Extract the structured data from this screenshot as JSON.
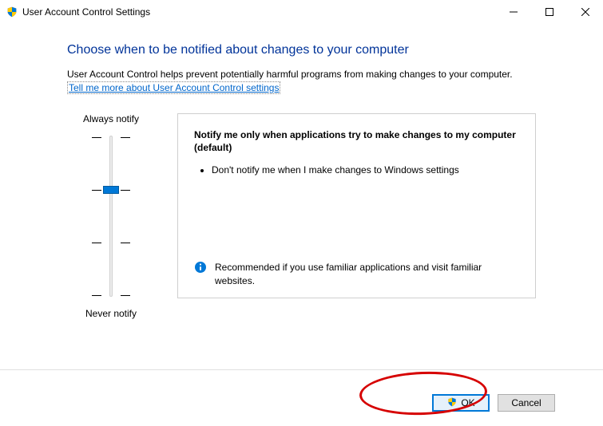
{
  "window": {
    "title": "User Account Control Settings"
  },
  "content": {
    "heading": "Choose when to be notified about changes to your computer",
    "intro": "User Account Control helps prevent potentially harmful programs from making changes to your computer.",
    "link": "Tell me more about User Account Control settings"
  },
  "slider": {
    "top_label": "Always notify",
    "bottom_label": "Never notify",
    "levels": 4,
    "selected_index": 1
  },
  "panel": {
    "title": "Notify me only when applications try to make changes to my computer (default)",
    "bullets": [
      "Don't notify me when I make changes to Windows settings"
    ],
    "recommendation": "Recommended if you use familiar applications and visit familiar websites."
  },
  "footer": {
    "ok": "OK",
    "cancel": "Cancel"
  }
}
